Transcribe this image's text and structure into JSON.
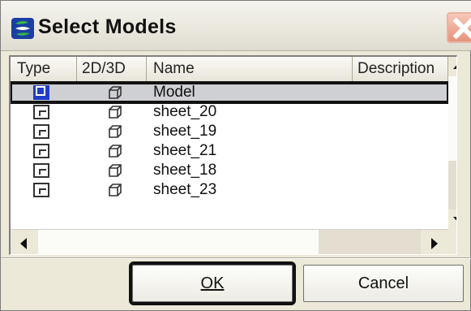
{
  "window": {
    "title": "Select Models",
    "app_icon": "microstation-icon",
    "close_icon": "close-icon"
  },
  "list": {
    "columns": [
      "Type",
      "2D/3D",
      "Name",
      "Description"
    ],
    "rows": [
      {
        "type_icon": "model-icon",
        "dim_icon": "3d-cube-icon",
        "name": "Model",
        "selected": true
      },
      {
        "type_icon": "sheet-icon",
        "dim_icon": "3d-cube-icon",
        "name": "sheet_20"
      },
      {
        "type_icon": "sheet-icon",
        "dim_icon": "3d-cube-icon",
        "name": "sheet_19"
      },
      {
        "type_icon": "sheet-icon",
        "dim_icon": "3d-cube-icon",
        "name": "sheet_21"
      },
      {
        "type_icon": "sheet-icon",
        "dim_icon": "3d-cube-icon",
        "name": "sheet_18"
      },
      {
        "type_icon": "sheet-icon",
        "dim_icon": "3d-cube-icon",
        "name": "sheet_23"
      }
    ]
  },
  "buttons": {
    "ok": "OK",
    "cancel": "Cancel"
  },
  "colors": {
    "dialog_bg": "#ece9d8",
    "selection_bg": "#cfd0d3",
    "model_icon": "#1f3dc9",
    "close_button": "#e7927b"
  }
}
